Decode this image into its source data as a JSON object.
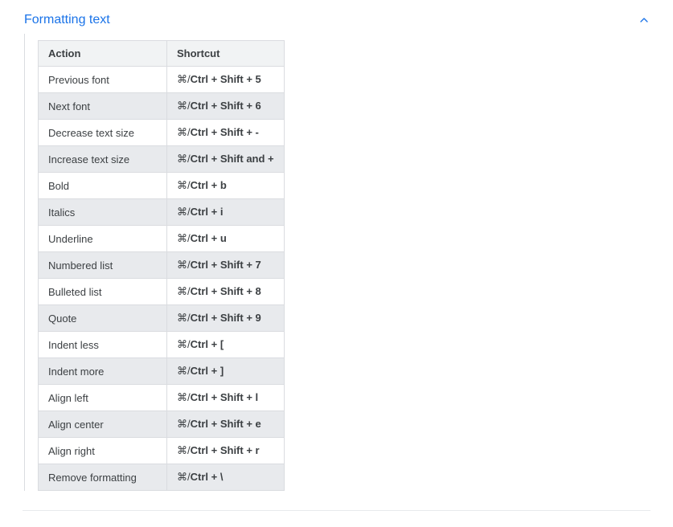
{
  "section": {
    "title": "Formatting text",
    "expanded": true
  },
  "table": {
    "headers": [
      "Action",
      "Shortcut"
    ],
    "rows": [
      {
        "action": "Previous font",
        "prefix": "⌘",
        "sep": "/",
        "combo": "Ctrl + Shift + 5"
      },
      {
        "action": "Next font",
        "prefix": "⌘",
        "sep": "/",
        "combo": "Ctrl + Shift + 6"
      },
      {
        "action": "Decrease text size",
        "prefix": "⌘",
        "sep": "/",
        "combo": "Ctrl + Shift + -"
      },
      {
        "action": "Increase text size",
        "prefix": "⌘",
        "sep": "/",
        "combo": "Ctrl + Shift and +"
      },
      {
        "action": "Bold",
        "prefix": "⌘",
        "sep": "/",
        "combo": "Ctrl + b"
      },
      {
        "action": "Italics",
        "prefix": "⌘",
        "sep": "/",
        "combo": "Ctrl + i"
      },
      {
        "action": "Underline",
        "prefix": "⌘",
        "sep": "/",
        "combo": "Ctrl + u"
      },
      {
        "action": "Numbered list",
        "prefix": "⌘",
        "sep": "/",
        "combo": "Ctrl + Shift + 7"
      },
      {
        "action": "Bulleted list",
        "prefix": "⌘",
        "sep": "/",
        "combo": "Ctrl + Shift + 8"
      },
      {
        "action": "Quote",
        "prefix": "⌘",
        "sep": "/",
        "combo": "Ctrl + Shift + 9"
      },
      {
        "action": "Indent less",
        "prefix": "⌘",
        "sep": "/",
        "combo": "Ctrl + ["
      },
      {
        "action": "Indent more",
        "prefix": "⌘",
        "sep": "/",
        "combo": "Ctrl + ]"
      },
      {
        "action": "Align left",
        "prefix": "⌘",
        "sep": "/",
        "combo": "Ctrl + Shift + l"
      },
      {
        "action": "Align center",
        "prefix": "⌘",
        "sep": "/",
        "combo": "Ctrl + Shift + e"
      },
      {
        "action": "Align right",
        "prefix": "⌘",
        "sep": "/",
        "combo": "Ctrl + Shift + r"
      },
      {
        "action": "Remove formatting",
        "prefix": "⌘",
        "sep": "/",
        "combo": "Ctrl + \\"
      }
    ]
  }
}
